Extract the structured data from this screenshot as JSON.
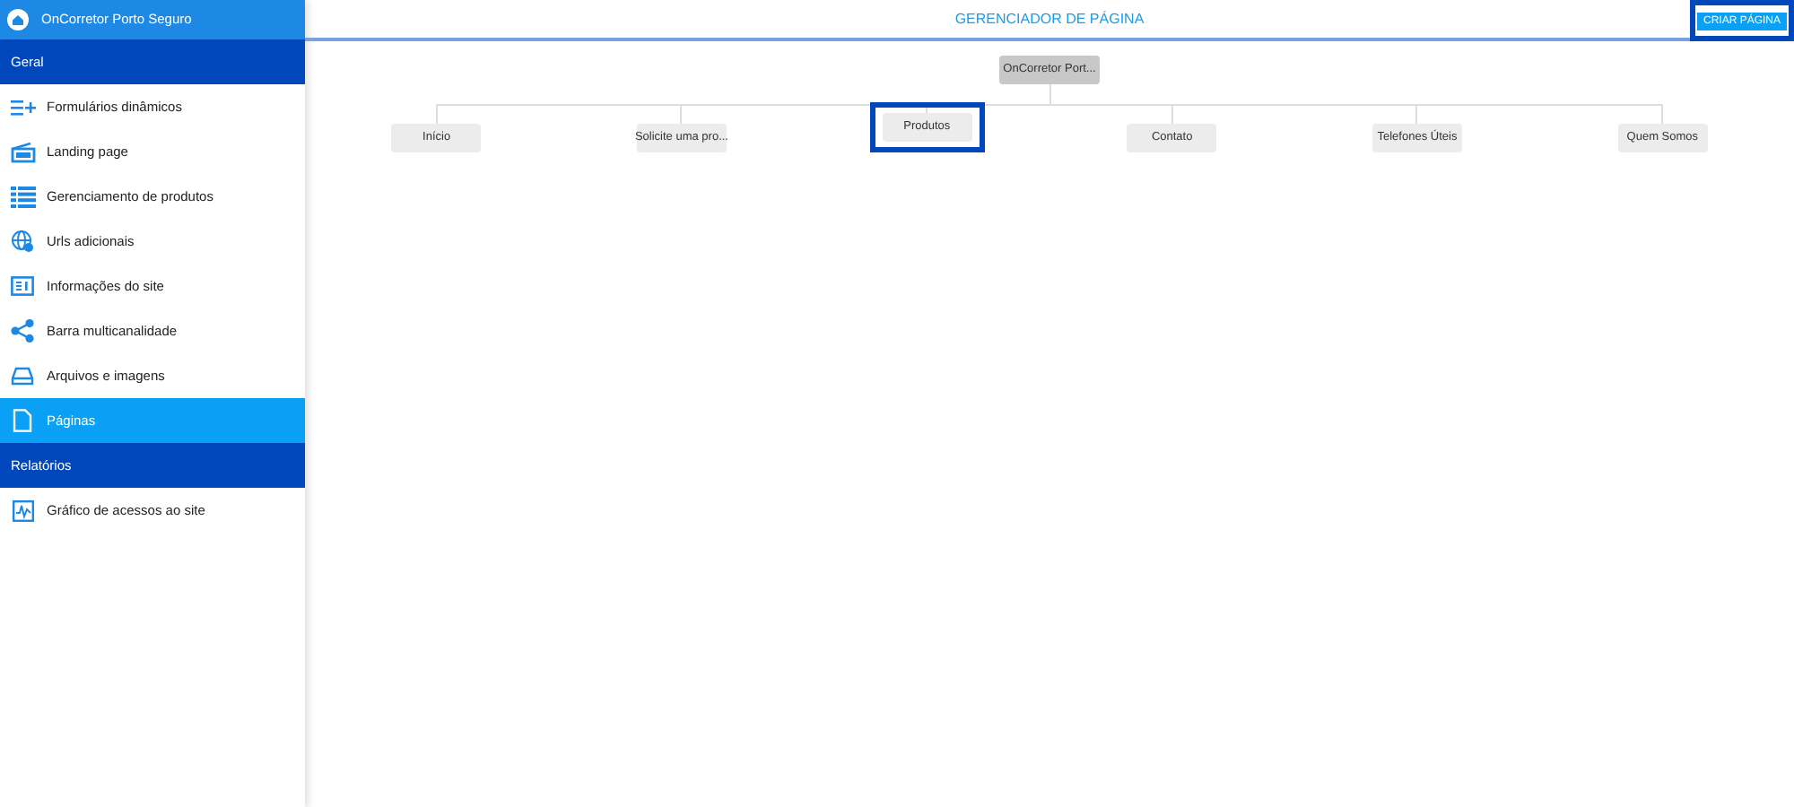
{
  "sidebar": {
    "title": "OnCorretor Porto Seguro",
    "sections": [
      {
        "label": "Geral",
        "items": [
          {
            "label": "Formulários dinâmicos",
            "selected": false
          },
          {
            "label": "Landing page",
            "selected": false
          },
          {
            "label": "Gerenciamento de produtos",
            "selected": false
          },
          {
            "label": "Urls adicionais",
            "selected": false
          },
          {
            "label": "Informações do site",
            "selected": false
          },
          {
            "label": "Barra multicanalidade",
            "selected": false
          },
          {
            "label": "Arquivos e imagens",
            "selected": false
          },
          {
            "label": "Páginas",
            "selected": true
          }
        ]
      },
      {
        "label": "Relatórios",
        "items": [
          {
            "label": "Gráfico de acessos ao site",
            "selected": false
          }
        ]
      }
    ]
  },
  "header": {
    "title": "GERENCIADOR DE PÁGINA",
    "button": {
      "label": "CRIAR PÁGINA",
      "highlighted": true
    }
  },
  "tree": {
    "root": "OnCorretor Port...",
    "children": [
      {
        "label": "Início",
        "highlighted": false
      },
      {
        "label": "Solicite uma pro...",
        "highlighted": false
      },
      {
        "label": "Produtos",
        "highlighted": true
      },
      {
        "label": "Contato",
        "highlighted": false
      },
      {
        "label": "Telefones Úteis",
        "highlighted": false
      },
      {
        "label": "Quem Somos",
        "highlighted": false
      }
    ]
  }
}
